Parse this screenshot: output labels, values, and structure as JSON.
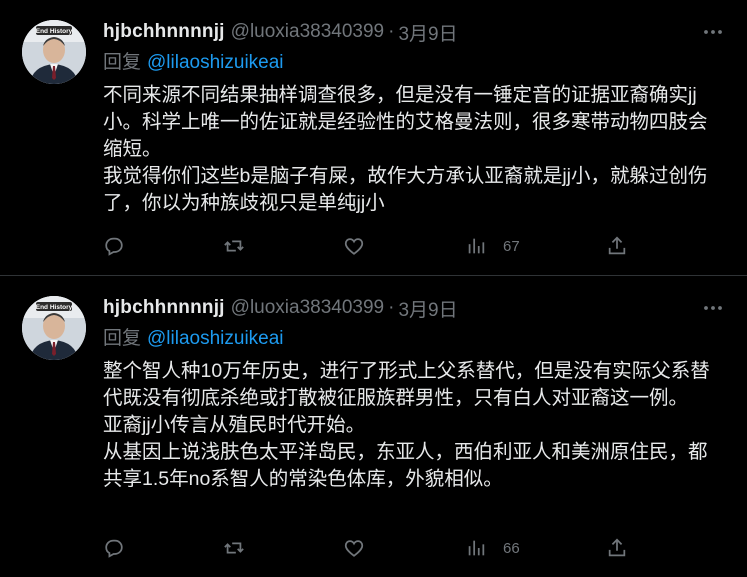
{
  "tweets": [
    {
      "author_name": "hjbchhnnnnjj",
      "handle": "@luoxia38340399",
      "separator": "·",
      "time": "3月9日",
      "reply_prefix": "回复",
      "reply_to": "@lilaoshizuikeai",
      "paragraphs": [
        "不同来源不同结果抽样调查很多，但是没有一锤定音的证据亚裔确实jj小。科学上唯一的佐证就是经验性的艾格曼法则，很多寒带动物四肢会缩短。",
        "我觉得你们这些b是脑子有屎，故作大方承认亚裔就是jj小，就躲过创伤了，你以为种族歧视只是单纯jj小"
      ],
      "views": "67",
      "avatar_badge": "End History"
    },
    {
      "author_name": "hjbchhnnnnjj",
      "handle": "@luoxia38340399",
      "separator": "·",
      "time": "3月9日",
      "reply_prefix": "回复",
      "reply_to": "@lilaoshizuikeai",
      "paragraphs": [
        "整个智人种10万年历史，进行了形式上父系替代，但是没有实际父系替代既没有彻底杀绝或打散被征服族群男性，只有白人对亚裔这一例。",
        "亚裔jj小传言从殖民时代开始。",
        "从基因上说浅肤色太平洋岛民，东亚人，西伯利亚人和美洲原住民，都共享1.5年no系智人的常染色体库，外貌相似。"
      ],
      "views": "66",
      "avatar_badge": "End History"
    }
  ],
  "colors": {
    "background": "#000000",
    "text": "#e7e9ea",
    "muted": "#71767b",
    "link": "#1d9bf0",
    "divider": "#2f3336"
  },
  "icons": [
    "reply-icon",
    "retweet-icon",
    "like-icon",
    "views-icon",
    "share-icon",
    "more-icon"
  ]
}
